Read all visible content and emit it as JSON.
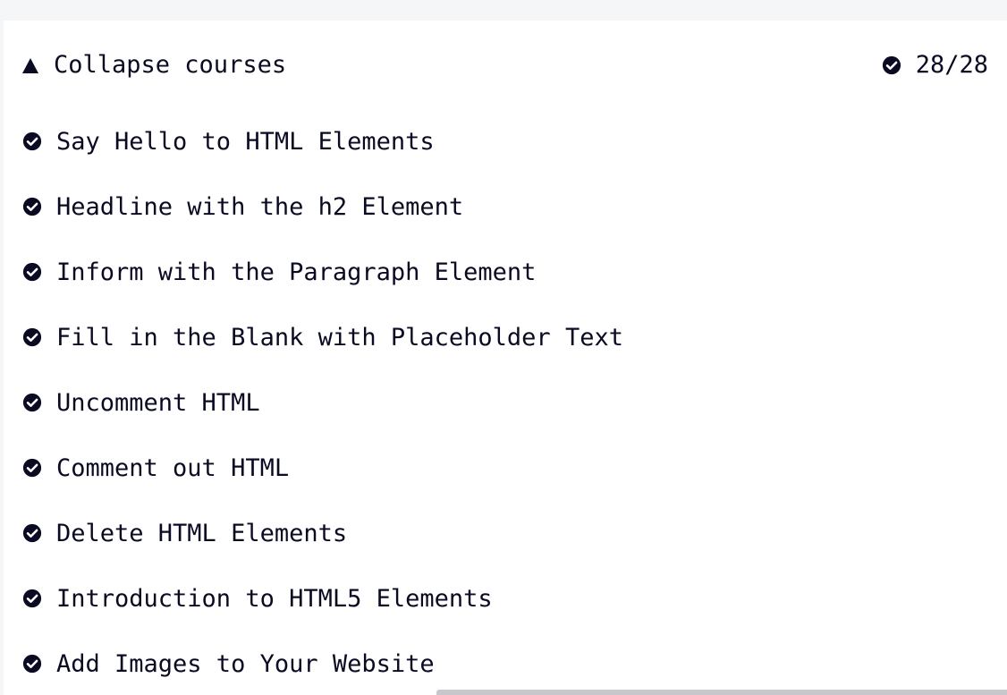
{
  "header": {
    "collapse_label": "Collapse courses",
    "progress": "28/28"
  },
  "icons": {
    "collapse": "triangle-up-icon",
    "completed": "check-circle-icon"
  },
  "colors": {
    "text": "#0a0a23",
    "panel": "#ffffff",
    "background": "#f5f6f7"
  },
  "lessons": [
    {
      "title": "Say Hello to HTML Elements",
      "completed": true
    },
    {
      "title": "Headline with the h2 Element",
      "completed": true
    },
    {
      "title": "Inform with the Paragraph Element",
      "completed": true
    },
    {
      "title": "Fill in the Blank with Placeholder Text",
      "completed": true
    },
    {
      "title": "Uncomment HTML",
      "completed": true
    },
    {
      "title": "Comment out HTML",
      "completed": true
    },
    {
      "title": "Delete HTML Elements",
      "completed": true
    },
    {
      "title": "Introduction to HTML5 Elements",
      "completed": true
    },
    {
      "title": "Add Images to Your Website",
      "completed": true
    }
  ]
}
